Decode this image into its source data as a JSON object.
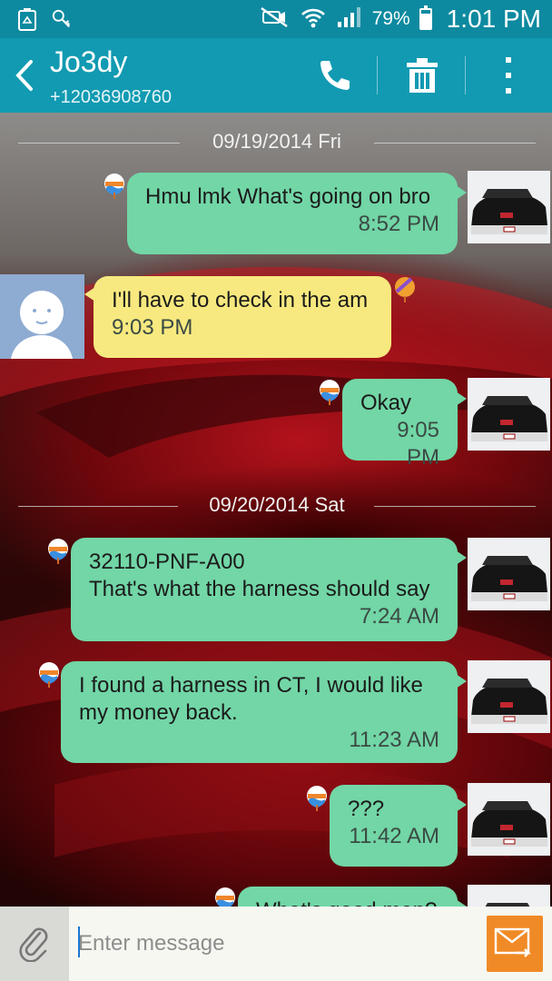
{
  "status_bar": {
    "battery_percent": "79%",
    "battery_level": 0.79,
    "time": "1:01 PM",
    "left_icons": [
      "recycle-icon",
      "tmobile-icon"
    ],
    "right_icons": [
      "mute-icon",
      "wifi-icon",
      "signal-icon",
      "battery-icon"
    ]
  },
  "header": {
    "contact_name": "Jo3dy",
    "phone_number": "+12036908760",
    "actions": [
      "call-icon",
      "delete-icon",
      "overflow-menu-icon"
    ]
  },
  "conversation": {
    "dates": [
      "09/19/2014 Fri",
      "09/20/2014 Sat"
    ],
    "messages": [
      {
        "direction": "out",
        "text": "Hmu lmk What's going on bro",
        "time": "8:52 PM"
      },
      {
        "direction": "in",
        "text": "I'll have to check in the am",
        "time": "9:03 PM"
      },
      {
        "direction": "out",
        "text": "Okay",
        "time": "9:05 PM"
      },
      {
        "direction": "out",
        "text": "32110-PNF-A00\nThat's what the harness should say",
        "time": "7:24 AM"
      },
      {
        "direction": "out",
        "text": "I found a harness in CT, I would like my money back.",
        "time": "11:23 AM"
      },
      {
        "direction": "out",
        "text": "???",
        "time": "11:42 AM"
      },
      {
        "direction": "out",
        "text": "What's good man?",
        "time": ""
      }
    ]
  },
  "composer": {
    "placeholder": "Enter message"
  },
  "colors": {
    "status_bar": "#0e8aa0",
    "action_bar": "#119ab2",
    "bubble_out": "#72d6a6",
    "bubble_in": "#f7e97f",
    "send_button": "#f08a26"
  }
}
